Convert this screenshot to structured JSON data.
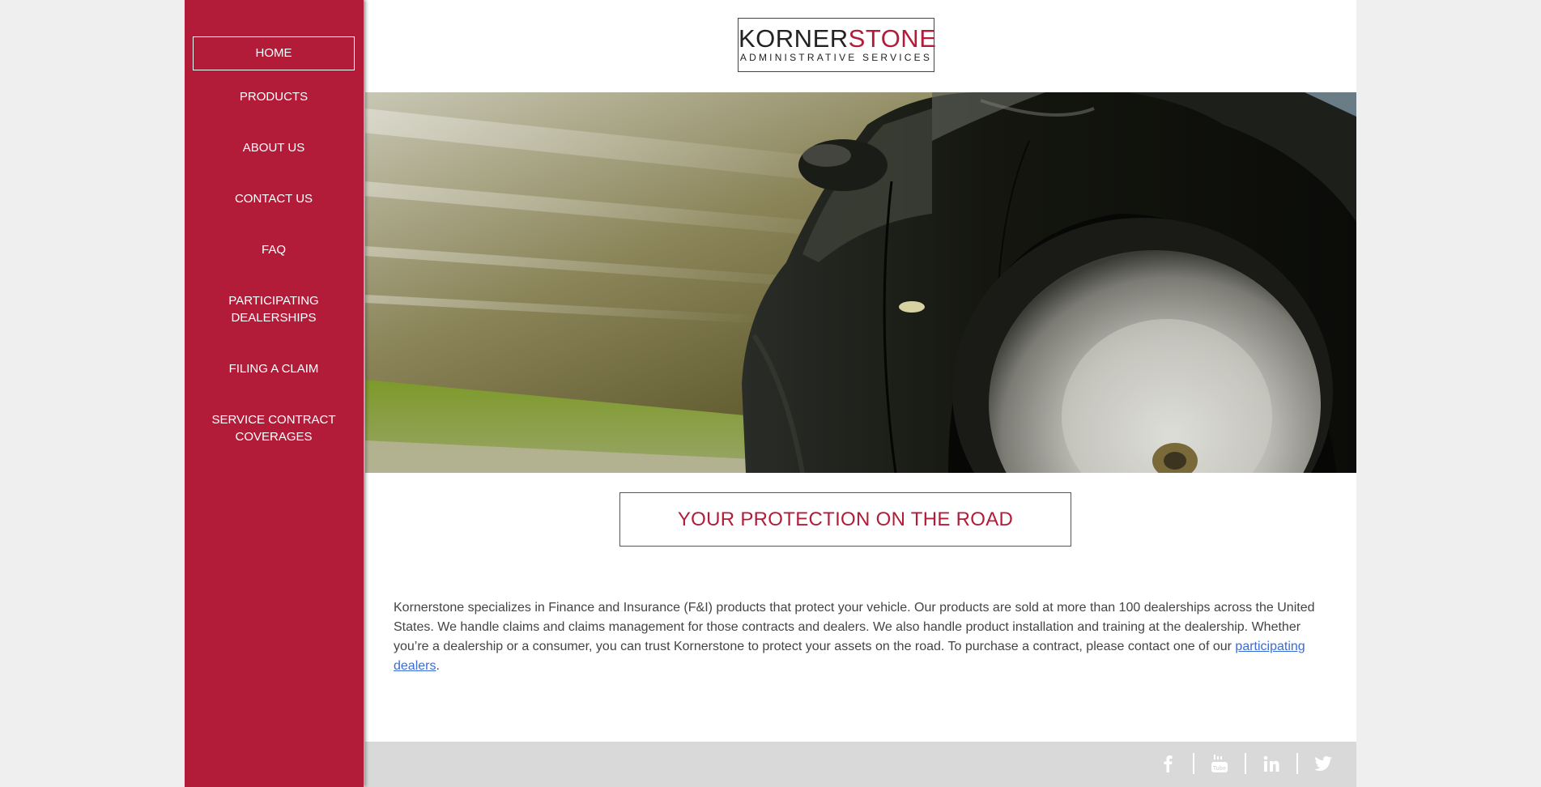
{
  "nav": {
    "items": [
      {
        "label": "HOME"
      },
      {
        "label": "PRODUCTS"
      },
      {
        "label": "ABOUT US"
      },
      {
        "label": "CONTACT US"
      },
      {
        "label": "FAQ"
      },
      {
        "label_line1": "PARTICIPATING",
        "label_line2": "DEALERSHIPS"
      },
      {
        "label": "FILING A CLAIM"
      },
      {
        "label_line1": "SERVICE CONTRACT",
        "label_line2": "COVERAGES"
      }
    ]
  },
  "logo": {
    "word_dark": "KORNER",
    "word_red": "STONE",
    "tagline": "ADMINISTRATIVE SERVICES"
  },
  "headline": "YOUR PROTECTION ON THE ROAD",
  "body": {
    "text": "Kornerstone specializes in Finance and Insurance (F&I) products that protect your vehicle. Our products are sold at more than 100 dealerships across the United States. We handle claims and claims management for those contracts and dealers.  We also handle product installation and training at the dealership. Whether you’re a dealership or a consumer, you can trust Kornerstone to protect your assets on the road. To purchase a contract, please contact one of our ",
    "link": "participating dealers",
    "end": "."
  },
  "footer": {
    "social": [
      "facebook-icon",
      "youtube-icon",
      "linkedin-icon",
      "twitter-icon"
    ]
  },
  "colors": {
    "brand_red": "#b21c39",
    "link_blue": "#3a6bd6",
    "footer_gray": "#d9d9d9"
  }
}
